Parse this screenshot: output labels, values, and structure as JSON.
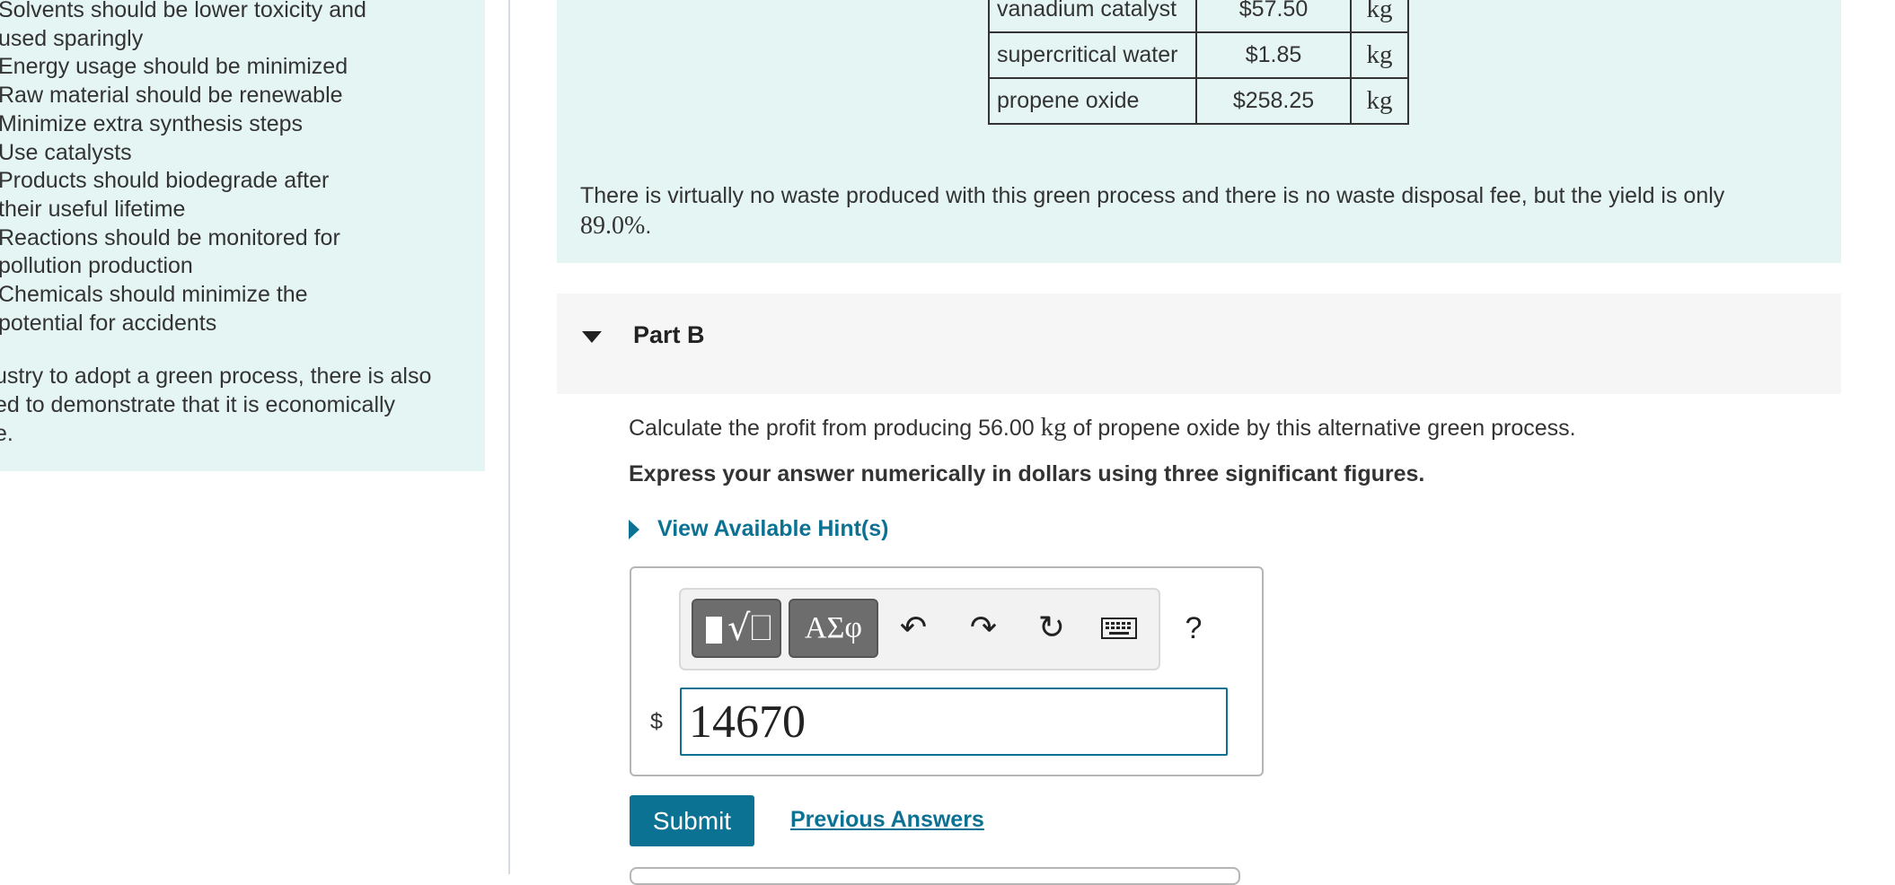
{
  "sidebar": {
    "items": [
      "Solvents should be lower toxicity and\nused sparingly",
      "Energy usage should be minimized",
      "Raw material should be renewable",
      "Minimize extra synthesis steps",
      "Use catalysts",
      "Products should biodegrade after\ntheir useful lifetime",
      "Reactions should be monitored for\npollution production",
      "Chemicals should minimize the\npotential for accidents"
    ],
    "paragraph": "ustry to adopt a green process, there is also\ned to demonstrate that it is economically\ne."
  },
  "cost_table": {
    "rows": [
      {
        "name": "vanadium catalyst",
        "price": "$57.50",
        "unit": "kg"
      },
      {
        "name": "supercritical water",
        "price": "$1.85",
        "unit": "kg"
      },
      {
        "name": "propene oxide",
        "price": "$258.25",
        "unit": "kg"
      }
    ]
  },
  "note": {
    "text": "There is virtually no waste produced with this green process and there is no waste disposal fee, but the yield is only",
    "yield_value": "89.0%",
    "end": "."
  },
  "part_b": {
    "title": "Part B",
    "question_pre": "Calculate the profit from producing 56.00",
    "question_unit": "kg",
    "question_post": "of propene oxide by this alternative green process.",
    "instruction": "Express your answer numerically in dollars using three significant figures.",
    "hints_label": "View Available Hint(s)"
  },
  "answer": {
    "currency_symbol": "$",
    "value": "14670",
    "toolbar": {
      "templates_icon": "templates-icon",
      "symbols_label": "ΑΣφ",
      "undo_icon": "undo-icon",
      "redo_icon": "redo-icon",
      "reset_icon": "reset-icon",
      "keyboard_icon": "keyboard-icon",
      "help_label": "?"
    }
  },
  "actions": {
    "submit_label": "Submit",
    "previous_answers_label": "Previous Answers"
  },
  "colors": {
    "accent": "#0b7294",
    "panel_bg": "#e5f5f4",
    "header_bg": "#f6f6f6"
  }
}
